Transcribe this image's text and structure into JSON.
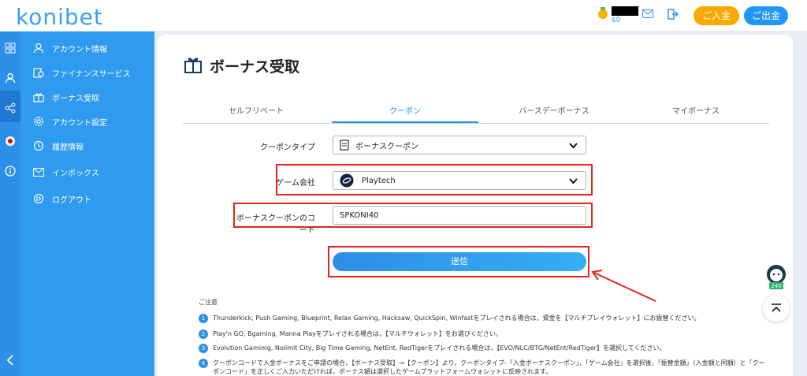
{
  "header": {
    "logo": "konibet",
    "balance": "$0",
    "deposit_label": "ご入金",
    "withdraw_label": "ご出金"
  },
  "sidebar": {
    "items": [
      {
        "label": "アカウント情報",
        "icon": "user-icon"
      },
      {
        "label": "ファイナンスサービス",
        "icon": "finance-icon"
      },
      {
        "label": "ボーナス受取",
        "icon": "gift-icon"
      },
      {
        "label": "アカウント設定",
        "icon": "gear-icon"
      },
      {
        "label": "履歴情報",
        "icon": "history-icon"
      },
      {
        "label": "インボックス",
        "icon": "mail-icon"
      },
      {
        "label": "ログアウト",
        "icon": "logout-icon"
      }
    ]
  },
  "page": {
    "title": "ボーナス受取",
    "tabs": [
      "セルフリベート",
      "クーポン",
      "バースデーボーナス",
      "マイボーナス"
    ],
    "active_tab": "クーポン",
    "coupon_type_label": "クーポンタイプ",
    "coupon_type_value": "ボーナスクーポン",
    "game_company_label": "ゲーム会社",
    "game_company_value": "Playtech",
    "coupon_code_label": "ボーナスクーポンのコード",
    "coupon_code_value": "SPKONI40",
    "submit_label": "送信"
  },
  "notes": {
    "title": "ご注意",
    "items": [
      {
        "num": "1",
        "text": "Thunderkick, Push Gaming, Blueprint, Relax Gaming, Hacksaw, QuickSpin, Winfastをプレイされる場合は，資金を【マルチプレイウォレット】にお振替ください。"
      },
      {
        "num": "2",
        "text": "Play'n GO, Bgaming, Manna Playをプレイされる場合は，【マルチウォレット】をお選びください。"
      },
      {
        "num": "3",
        "text": "Evolution Gamimg, Nolimit City, Big Time Gaming, NetEnt, RedTigerをプレイされる場合は，【EVO/NLC/BTG/NetEnt/RedTiger】を選択してください。"
      },
      {
        "num": "4",
        "text": "クーポンコードで入金ボーナスをご申請の場合，【ボーナス受取】→【クーポン】より，クーポンタイプ-「入金ボーナスクーポン」，「ゲーム会社」を選択後，「振替金額」（入金額と同額）と「クーポンコード」を正しくご入力いただければ，ボーナス額は選択したゲームプラットフォームウォレットに反映されます。"
      }
    ]
  },
  "colors": {
    "accent": "#2c8fe8",
    "sidebar": "#2f9bf0",
    "deposit": "#f6a900",
    "highlight": "#e0261f"
  }
}
